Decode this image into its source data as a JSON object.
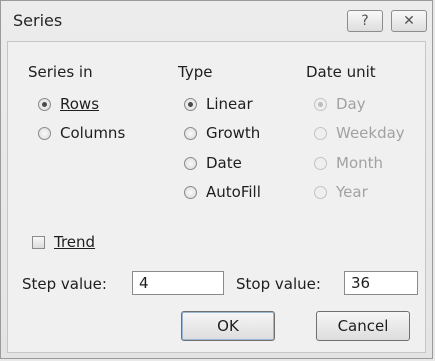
{
  "title": "Series",
  "titlebar": {
    "help_glyph": "?",
    "close_glyph": "✕"
  },
  "series_in": {
    "title": "Series in",
    "options": [
      {
        "label": "Rows",
        "selected": true
      },
      {
        "label": "Columns",
        "selected": false
      }
    ]
  },
  "type": {
    "title": "Type",
    "options": [
      {
        "label": "Linear",
        "selected": true
      },
      {
        "label": "Growth",
        "selected": false
      },
      {
        "label": "Date",
        "selected": false
      },
      {
        "label": "AutoFill",
        "selected": false
      }
    ]
  },
  "date_unit": {
    "title": "Date unit",
    "options": [
      {
        "label": "Day",
        "selected": true
      },
      {
        "label": "Weekday",
        "selected": false
      },
      {
        "label": "Month",
        "selected": false
      },
      {
        "label": "Year",
        "selected": false
      }
    ]
  },
  "trend": {
    "label": "Trend",
    "checked": false
  },
  "step": {
    "label": "Step value:",
    "value": "4"
  },
  "stop": {
    "label": "Stop value:",
    "value": "36"
  },
  "buttons": {
    "ok": "OK",
    "cancel": "Cancel"
  }
}
